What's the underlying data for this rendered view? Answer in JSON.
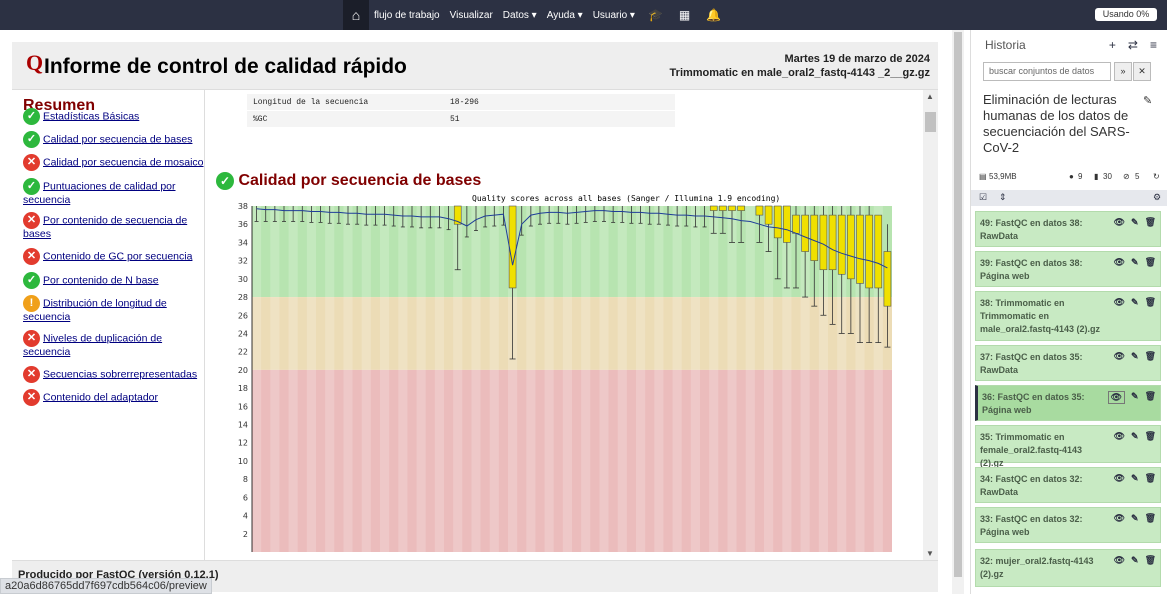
{
  "nav": {
    "items": [
      "flujo de trabajo",
      "Visualizar",
      "Datos ▾",
      "Ayuda ▾",
      "Usuario ▾"
    ],
    "usage": "Usando 0%"
  },
  "report": {
    "logo_letter": "Q",
    "title": "Informe de control de calidad rápido",
    "date": "Martes 19 de marzo de 2024",
    "filename": "Trimmomatic en male_oral2_fastq-4143 _2__gz.gz",
    "summary_title": "Resumen",
    "summary_items": [
      {
        "label": "Estadísticas Básicas",
        "status": "ok"
      },
      {
        "label": "Calidad por secuencia de bases",
        "status": "ok"
      },
      {
        "label": "Calidad por secuencia de mosaico",
        "status": "bad"
      },
      {
        "label": "Puntuaciones de calidad por secuencia",
        "status": "ok"
      },
      {
        "label": "Por contenido de secuencia de bases",
        "status": "bad"
      },
      {
        "label": "Contenido de GC por secuencia",
        "status": "bad"
      },
      {
        "label": "Por contenido de N base",
        "status": "ok"
      },
      {
        "label": "Distribución de longitud de secuencia",
        "status": "warn"
      },
      {
        "label": "Niveles de duplicación de secuencia",
        "status": "bad"
      },
      {
        "label": "Secuencias sobrerrepresentadas",
        "status": "bad"
      },
      {
        "label": "Contenido del adaptador",
        "status": "bad"
      }
    ],
    "table": [
      [
        "Longitud de la secuencia",
        "18-296"
      ],
      [
        "%GC",
        "51"
      ]
    ],
    "section_title": "Calidad por secuencia de bases",
    "footer": "Producido por FastQC (versión 0.12.1)"
  },
  "chart_data": {
    "type": "box",
    "title": "Quality scores across all bases (Sanger / Illumina 1.9 encoding)",
    "ylim": [
      0,
      38
    ],
    "yticks": [
      2,
      4,
      6,
      8,
      10,
      12,
      14,
      16,
      18,
      20,
      22,
      24,
      26,
      28,
      30,
      32,
      34,
      36,
      38
    ],
    "bands": [
      {
        "from": 28,
        "to": 38,
        "color": "#b7e4b0"
      },
      {
        "from": 20,
        "to": 28,
        "color": "#ecdcb6"
      },
      {
        "from": 0,
        "to": 20,
        "color": "#ebbcbc"
      }
    ],
    "mean_line": [
      37.7,
      37.6,
      37.6,
      37.5,
      37.5,
      37.5,
      37.4,
      37.4,
      37.3,
      37.3,
      37.2,
      37.2,
      37.1,
      37.1,
      37.1,
      37.0,
      36.9,
      36.9,
      36.8,
      36.8,
      36.8,
      36.6,
      36.3,
      35.8,
      36.5,
      36.9,
      37.0,
      37.1,
      31.5,
      36.0,
      37.0,
      37.2,
      37.3,
      37.3,
      37.2,
      37.3,
      37.4,
      37.5,
      37.5,
      37.4,
      37.4,
      37.3,
      37.3,
      37.2,
      37.2,
      37.1,
      37.0,
      37.0,
      36.9,
      36.9,
      36.8,
      36.7,
      36.6,
      36.4,
      36.3,
      36.0,
      35.7,
      35.6,
      35.4,
      35.0,
      34.6,
      34.2,
      33.8,
      33.2,
      32.8,
      32.5,
      32.2,
      32.0,
      31.7,
      31.2
    ],
    "boxes": [
      {
        "i": 22,
        "q1": 36.0,
        "q3": 38,
        "lo": 31,
        "hi": 38
      },
      {
        "i": 28,
        "q1": 29.0,
        "q3": 38,
        "lo": 21.2,
        "hi": 38
      },
      {
        "i": 50,
        "q1": 37.5,
        "q3": 38,
        "lo": 35,
        "hi": 38
      },
      {
        "i": 51,
        "q1": 37.5,
        "q3": 38,
        "lo": 35,
        "hi": 38
      },
      {
        "i": 52,
        "q1": 37.5,
        "q3": 38,
        "lo": 34,
        "hi": 38
      },
      {
        "i": 53,
        "q1": 37.5,
        "q3": 38,
        "lo": 34,
        "hi": 38
      },
      {
        "i": 55,
        "q1": 37.0,
        "q3": 38,
        "lo": 34,
        "hi": 38
      },
      {
        "i": 56,
        "q1": 36.0,
        "q3": 38,
        "lo": 33,
        "hi": 38
      },
      {
        "i": 57,
        "q1": 34.5,
        "q3": 38,
        "lo": 30,
        "hi": 38
      },
      {
        "i": 58,
        "q1": 34.0,
        "q3": 38,
        "lo": 29,
        "hi": 38
      },
      {
        "i": 59,
        "q1": 35.0,
        "q3": 37,
        "lo": 29,
        "hi": 38
      },
      {
        "i": 60,
        "q1": 33.0,
        "q3": 37,
        "lo": 28,
        "hi": 38
      },
      {
        "i": 61,
        "q1": 32.0,
        "q3": 37,
        "lo": 27,
        "hi": 38
      },
      {
        "i": 62,
        "q1": 31.0,
        "q3": 37,
        "lo": 26,
        "hi": 38
      },
      {
        "i": 63,
        "q1": 31.0,
        "q3": 37,
        "lo": 25,
        "hi": 38
      },
      {
        "i": 64,
        "q1": 30.5,
        "q3": 37,
        "lo": 24,
        "hi": 38
      },
      {
        "i": 65,
        "q1": 30.0,
        "q3": 37,
        "lo": 24,
        "hi": 38
      },
      {
        "i": 66,
        "q1": 29.5,
        "q3": 37,
        "lo": 23,
        "hi": 38
      },
      {
        "i": 67,
        "q1": 29.0,
        "q3": 37,
        "lo": 23,
        "hi": 38
      },
      {
        "i": 68,
        "q1": 29.0,
        "q3": 37,
        "lo": 23,
        "hi": 37
      },
      {
        "i": 69,
        "q1": 27.0,
        "q3": 33,
        "lo": 22.5,
        "hi": 36
      }
    ]
  },
  "history": {
    "title": "Historia",
    "search_placeholder": "buscar conjuntos de datos",
    "name": "Eliminación de lecturas humanas de los datos de secuenciación del SARS-CoV-2",
    "size": "53,9MB",
    "count_a": "9",
    "count_b": "30",
    "count_c": "5",
    "items": [
      {
        "label": "49: FastQC en datos 38: RawData"
      },
      {
        "label": "39: FastQC en datos 38: Página web"
      },
      {
        "label": "38: Trimmomatic en Trimmomatic en male_oral2.fastq-4143 (2).gz"
      },
      {
        "label": "37: FastQC en datos 35: RawData"
      },
      {
        "label": "36: FastQC en datos 35: Página web"
      },
      {
        "label": "35: Trimmomatic en female_oral2.fastq-4143 (2).gz"
      },
      {
        "label": "34: FastQC en datos 32: RawData"
      },
      {
        "label": "33: FastQC en datos 32: Página web"
      },
      {
        "label": "32: mujer_oral2.fastq-4143 (2).gz"
      }
    ]
  },
  "status_url": "a20a6d86765dd7f697cdb564c06/preview"
}
